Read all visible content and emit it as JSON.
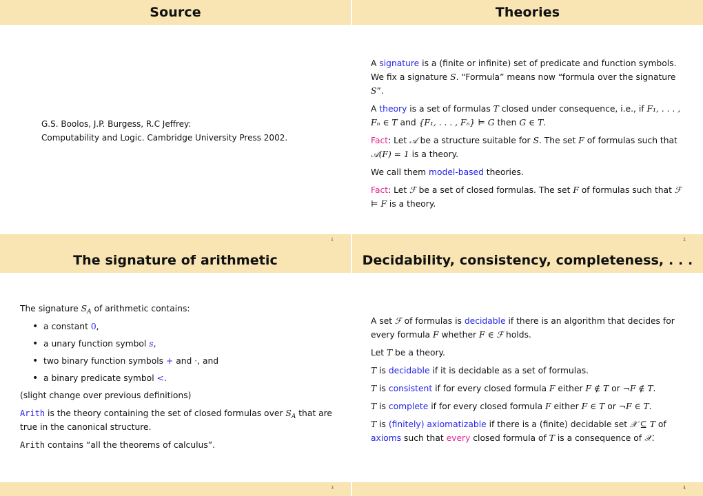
{
  "slides": [
    {
      "title": "Source",
      "page": "1",
      "reference": {
        "line1": "G.S. Boolos, J.P. Burgess, R.C Jeffrey:",
        "line2": "Computability and Logic. Cambridge University Press 2002."
      }
    },
    {
      "title": "Theories",
      "page": "2",
      "p1": {
        "a": "A ",
        "term": "signature",
        "b": " is a (finite or infinite) set of predicate and function symbols. We fix a signature ",
        "S": "S",
        "c": ". “Formula” means now “formula over the signature ",
        "S2": "S",
        "d": "”."
      },
      "p2": {
        "a": "A ",
        "term": "theory",
        "b": " is a set of formulas ",
        "T": "T",
        "c": " closed under consequence, i.e., if ",
        "math1": "F₁, . . . , Fₙ ∈ T",
        "d": " and ",
        "math2": "{F₁, . . . , Fₙ} ⊨ G",
        "e": " then ",
        "math3": "G ∈ T",
        "f": "."
      },
      "p3": {
        "fact": "Fact",
        "a": ": Let ",
        "A": "𝒜",
        "b": " be a structure suitable for ",
        "S": "S",
        "c": ". The set ",
        "F": "F",
        "d": " of formulas such that ",
        "math": "𝒜(F) = 1",
        "e": " is a theory."
      },
      "p4": {
        "a": "We call them ",
        "term": "model-based",
        "b": " theories."
      },
      "p5": {
        "fact": "Fact",
        "a": ": Let ",
        "calF": "ℱ",
        "b": " be a set of closed formulas. The set ",
        "F": "F",
        "c": " of formulas such that ",
        "math": "ℱ ⊨ F",
        "d": " is a theory."
      }
    },
    {
      "title": "The signature of arithmetic",
      "page": "3",
      "intro": {
        "a": "The signature ",
        "S": "S",
        "sub": "A",
        "b": " of arithmetic contains:"
      },
      "items": [
        {
          "a": "a constant ",
          "sym": "0",
          "b": ","
        },
        {
          "a": "a unary function symbol ",
          "sym": "s",
          "b": ","
        },
        {
          "a": "two binary function symbols ",
          "sym": "+",
          "b": " and ",
          "sym2": "·",
          "c": ", and"
        },
        {
          "a": "a binary predicate symbol ",
          "sym": "<",
          "b": "."
        }
      ],
      "note": "(slight change over previous definitions)",
      "arith_def": {
        "name": "Arith",
        "a": " is the theory containing the set of closed formulas over ",
        "S": "S",
        "sub": "A",
        "b": " that are true in the canonical structure."
      },
      "arith_calc": {
        "name": "Arith",
        "a": " contains “all the theorems of calculus”."
      }
    },
    {
      "title": "Decidability, consistency, completeness, . . .",
      "page": "4",
      "p1": {
        "a": "A set ",
        "calF": "ℱ",
        "b": " of formulas is ",
        "term": "decidable",
        "c": " if there is an algorithm that decides for every formula ",
        "F": "F",
        "d": " whether ",
        "math": "F ∈ ℱ",
        "e": " holds."
      },
      "p2": {
        "a": "Let ",
        "T": "T",
        "b": " be a theory."
      },
      "p3": {
        "T": "T",
        "a": " is ",
        "term": "decidable",
        "b": " if it is decidable as a set of formulas."
      },
      "p4": {
        "T": "T",
        "a": " is ",
        "term": "consistent",
        "b": " if for every closed formula ",
        "F": "F",
        "c": " either ",
        "m1": "F ∉ T",
        "d": " or ",
        "m2": "¬F ∉ T",
        "e": "."
      },
      "p5": {
        "T": "T",
        "a": " is ",
        "term": "complete",
        "b": " if for every closed formula ",
        "F": "F",
        "c": " either ",
        "m1": "F ∈ T",
        "d": " or ",
        "m2": "¬F ∈ T",
        "e": "."
      },
      "p6": {
        "T": "T",
        "a": " is ",
        "term": "(finitely) axiomatizable",
        "b": " if there is a (finite) decidable set ",
        "m1": "𝒳 ⊆ T",
        "c": " of ",
        "term2": "axioms",
        "d": " such that ",
        "em": "every",
        "e": " closed formula of ",
        "T2": "T",
        "f": " is a consequence of ",
        "X": "𝒳",
        "g": "."
      }
    }
  ],
  "colors": {
    "header_band": "#f9e5b3",
    "term_blue": "#2323e8",
    "fact_pink": "#e5268f"
  }
}
